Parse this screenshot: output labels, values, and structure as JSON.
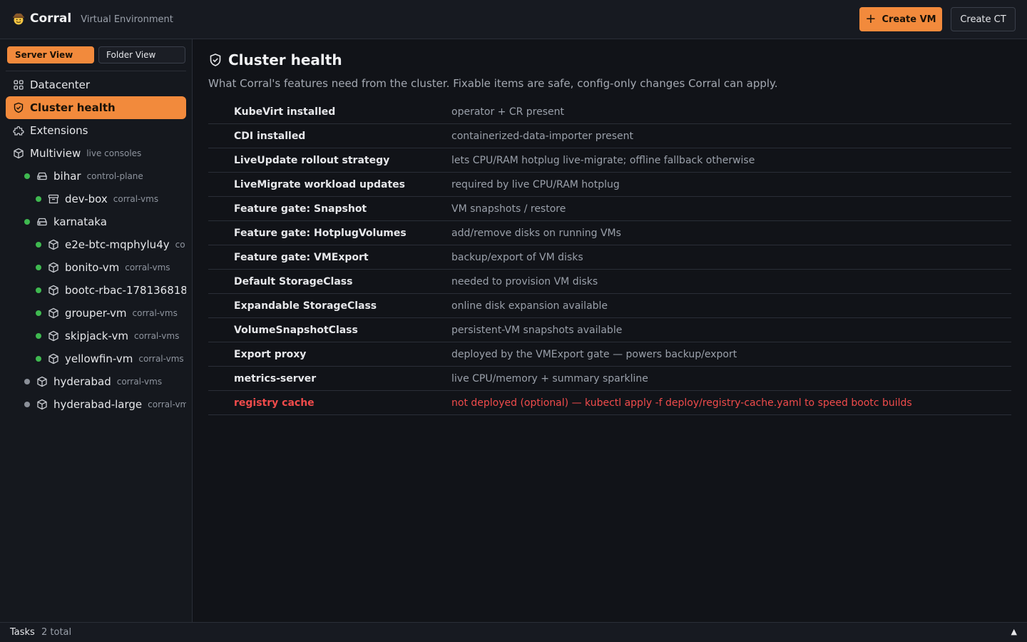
{
  "app": {
    "logo_icon": "cowboy-hat-face-icon",
    "name": "Corral",
    "subtitle": "Virtual Environment"
  },
  "toolbar": {
    "create_vm_icon": "plus-icon",
    "create_vm_label": "Create VM",
    "create_ct_label": "Create CT"
  },
  "sidebar": {
    "view_tabs": [
      {
        "label": "Server View",
        "active": true
      },
      {
        "label": "Folder View",
        "active": false
      }
    ],
    "items": [
      {
        "label": "Datacenter",
        "icon": "grid-icon",
        "active": false
      },
      {
        "label": "Cluster health",
        "icon": "shield-check-icon",
        "active": true
      },
      {
        "label": "Extensions",
        "icon": "puzzle-icon",
        "active": false
      },
      {
        "label": "Multiview",
        "sub": "live consoles",
        "icon": "cube-icon",
        "active": false
      }
    ],
    "nodes": [
      {
        "label": "bihar",
        "sub": "control-plane",
        "icon": "server-icon",
        "status": "green"
      },
      {
        "label": "dev-box",
        "sub": "corral-vms",
        "icon": "archive-icon",
        "status": "green"
      },
      {
        "label": "karnataka",
        "sub": "",
        "icon": "server-icon",
        "status": "green"
      },
      {
        "label": "e2e-btc-mqphylu4y",
        "sub": "co",
        "icon": "cube-icon",
        "status": "green"
      },
      {
        "label": "bonito-vm",
        "sub": "corral-vms",
        "icon": "cube-icon",
        "status": "green"
      },
      {
        "label": "bootc-rbac-178136818",
        "sub": "",
        "icon": "cube-icon",
        "status": "green"
      },
      {
        "label": "grouper-vm",
        "sub": "corral-vms",
        "icon": "cube-icon",
        "status": "green"
      },
      {
        "label": "skipjack-vm",
        "sub": "corral-vms",
        "icon": "cube-icon",
        "status": "green"
      },
      {
        "label": "yellowfin-vm",
        "sub": "corral-vms",
        "icon": "cube-icon",
        "status": "green"
      },
      {
        "label": "hyderabad",
        "sub": "corral-vms",
        "icon": "cube-icon",
        "status": "gray"
      },
      {
        "label": "hyderabad-large",
        "sub": "corral-vm",
        "icon": "cube-icon",
        "status": "gray"
      }
    ]
  },
  "main": {
    "title_icon": "shield-check-icon",
    "title": "Cluster health",
    "description": "What Corral's features need from the cluster. Fixable items are safe, config-only changes Corral can apply.",
    "checks": [
      {
        "name": "KubeVirt installed",
        "detail": "operator + CR present",
        "status": "ok"
      },
      {
        "name": "CDI installed",
        "detail": "containerized-data-importer present",
        "status": "ok"
      },
      {
        "name": "LiveUpdate rollout strategy",
        "detail": "lets CPU/RAM hotplug live-migrate; offline fallback otherwise",
        "status": "ok"
      },
      {
        "name": "LiveMigrate workload updates",
        "detail": "required by live CPU/RAM hotplug",
        "status": "ok"
      },
      {
        "name": "Feature gate: Snapshot",
        "detail": "VM snapshots / restore",
        "status": "ok"
      },
      {
        "name": "Feature gate: HotplugVolumes",
        "detail": "add/remove disks on running VMs",
        "status": "ok"
      },
      {
        "name": "Feature gate: VMExport",
        "detail": "backup/export of VM disks",
        "status": "ok"
      },
      {
        "name": "Default StorageClass",
        "detail": "needed to provision VM disks",
        "status": "ok"
      },
      {
        "name": "Expandable StorageClass",
        "detail": "online disk expansion available",
        "status": "ok"
      },
      {
        "name": "VolumeSnapshotClass",
        "detail": "persistent-VM snapshots available",
        "status": "ok"
      },
      {
        "name": "Export proxy",
        "detail": "deployed by the VMExport gate — powers backup/export",
        "status": "ok"
      },
      {
        "name": "metrics-server",
        "detail": "live CPU/memory + summary sparkline",
        "status": "ok"
      },
      {
        "name": "registry cache",
        "detail": "not deployed (optional) — kubectl apply -f deploy/registry-cache.yaml to speed bootc builds",
        "status": "error"
      }
    ]
  },
  "footer": {
    "tasks_label": "Tasks",
    "tasks_count": "2 total",
    "toggle_icon": "triangle-up-icon",
    "toggle_glyph": "▲"
  },
  "colors": {
    "accent": "#f28a3c",
    "status_ok": "#3fb950",
    "status_idle": "#8b9099",
    "error": "#f04b4b"
  }
}
